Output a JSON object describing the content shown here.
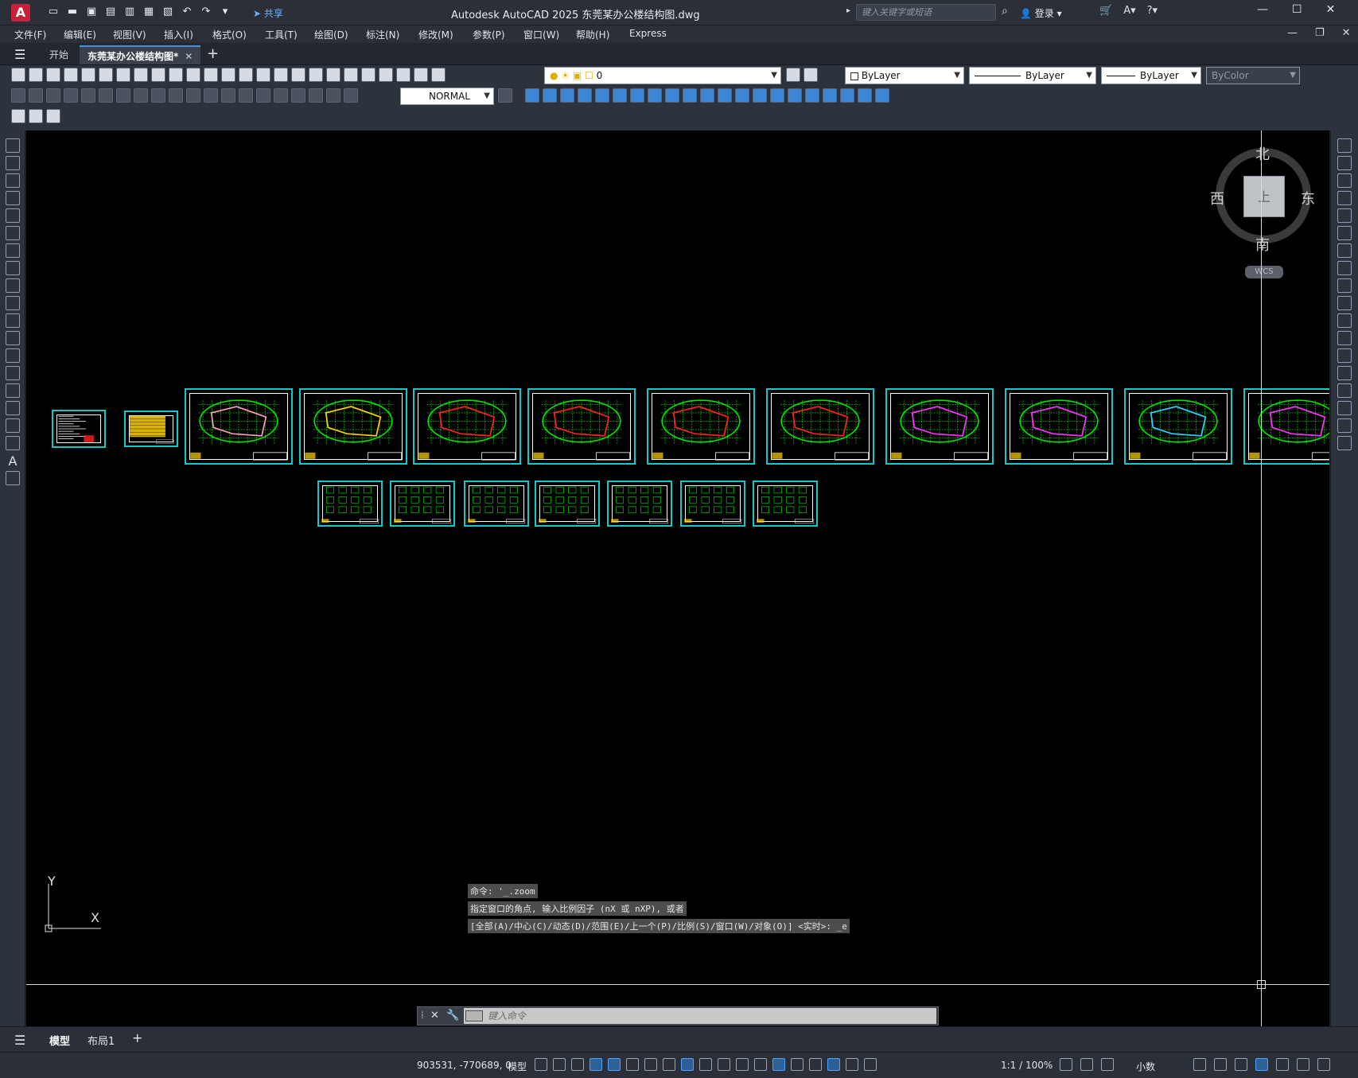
{
  "app": {
    "logo": "A",
    "title": "Autodesk AutoCAD 2025    东莞某办公楼结构图.dwg",
    "share": "共享",
    "search_placeholder": "键入关键字或短语",
    "login": "登录"
  },
  "menu": [
    "文件(F)",
    "编辑(E)",
    "视图(V)",
    "插入(I)",
    "格式(O)",
    "工具(T)",
    "绘图(D)",
    "标注(N)",
    "修改(M)",
    "参数(P)",
    "窗口(W)",
    "帮助(H)",
    "Express"
  ],
  "tabs": {
    "start": "开始",
    "drawing": "东莞某办公楼结构图*"
  },
  "properties": {
    "layer": "0",
    "color": "ByLayer",
    "linetype": "ByLayer",
    "lineweight": "ByLayer",
    "plotstyle": "ByColor",
    "dimstyle": "NORMAL"
  },
  "viewcube": {
    "north": "北",
    "south": "南",
    "west": "西",
    "east": "东",
    "face": "上",
    "wcs": "WCS"
  },
  "ucs": {
    "x": "X",
    "y": "Y"
  },
  "command": {
    "history": [
      "命令: '_.zoom",
      "指定窗口的角点, 输入比例因子 (nX 或 nXP), 或者",
      "[全部(A)/中心(C)/动态(D)/范围(E)/上一个(P)/比例(S)/窗口(W)/对象(O)] <实时>: _e"
    ],
    "placeholder": "键入命令"
  },
  "layouts": {
    "model": "模型",
    "layout1": "布局1"
  },
  "status": {
    "coords": "903531, -770689, 0",
    "model": "模型",
    "annotation_scale": "1:1 / 100%",
    "units": "小数"
  },
  "colors": {
    "sheet_border": "#15c7c7",
    "grid_green": "#00e600",
    "highlight_red": "#ff2020",
    "highlight_yellow": "#ffd200",
    "highlight_magenta": "#ff30ff",
    "highlight_cyan": "#30d0ff"
  }
}
